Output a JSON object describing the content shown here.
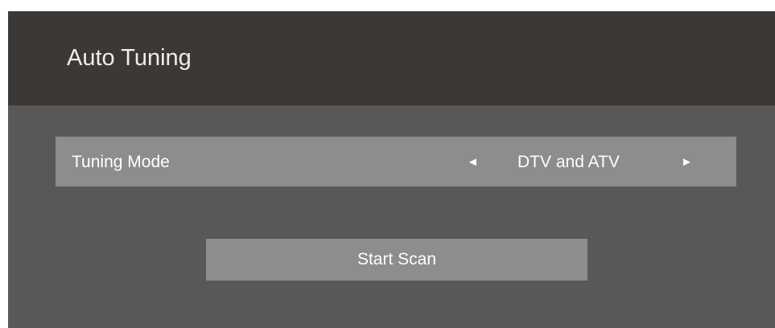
{
  "header": {
    "title": "Auto Tuning"
  },
  "tuning_mode": {
    "label": "Tuning Mode",
    "value": "DTV and ATV",
    "left_arrow": "◄",
    "right_arrow": "►"
  },
  "actions": {
    "start_scan_label": "Start Scan"
  },
  "colors": {
    "header_bg": "#3c3836",
    "panel_bg": "#595757",
    "row_bg": "#8e8c8c",
    "text": "#ffffff"
  }
}
